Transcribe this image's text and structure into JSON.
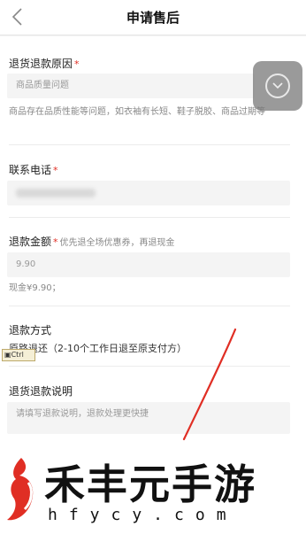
{
  "nav": {
    "title": "申请售后"
  },
  "reason": {
    "label": "退货退款原因",
    "required": "*",
    "value": "商品质量问题",
    "description": "商品存在品质性能等问题，如衣袖有长短、鞋子脱胶、商品过期等"
  },
  "phone": {
    "label": "联系电话",
    "required": "*"
  },
  "amount": {
    "label": "退款金额",
    "required": "*",
    "hint": "优先退全场优惠券，再退现金",
    "value": "9.90",
    "cash_note": "现金¥9.90；"
  },
  "method": {
    "label": "退款方式",
    "value": "原路退还（2-10个工作日退至原支付方）"
  },
  "explain": {
    "label": "退货退款说明",
    "placeholder": "请填写退款说明，退款处理更快捷"
  },
  "overlay": {
    "clip_badge": "Ctrl"
  },
  "watermark": {
    "title": "禾丰元手游",
    "url": "hfycy.com"
  },
  "colors": {
    "required": "#e02e24",
    "accent": "#e02e24"
  }
}
